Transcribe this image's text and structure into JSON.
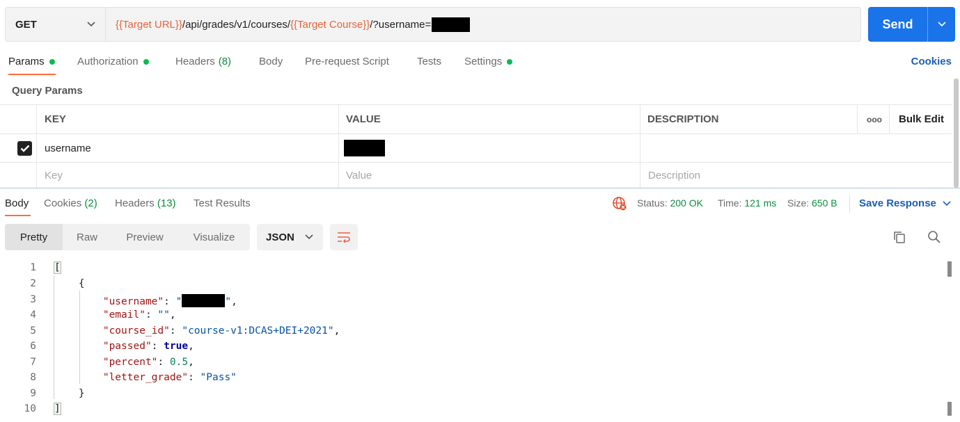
{
  "request": {
    "method": "GET",
    "url_parts": [
      {
        "text": "{{Target URL}}",
        "kind": "var"
      },
      {
        "text": "/api/grades/v1/courses/",
        "kind": "plain"
      },
      {
        "text": "{{Target Course}}",
        "kind": "var"
      },
      {
        "text": "/?username=",
        "kind": "plain"
      }
    ],
    "send_label": "Send"
  },
  "request_tabs": [
    {
      "label": "Params",
      "dot": true,
      "active": true
    },
    {
      "label": "Authorization",
      "dot": true
    },
    {
      "label": "Headers",
      "count": "(8)"
    },
    {
      "label": "Body"
    },
    {
      "label": "Pre-request Script"
    },
    {
      "label": "Tests"
    },
    {
      "label": "Settings",
      "dot": true
    }
  ],
  "cookies_link": "Cookies",
  "query_params": {
    "title": "Query Params",
    "headers": {
      "key": "KEY",
      "value": "VALUE",
      "description": "DESCRIPTION",
      "more": "ooo",
      "bulk_edit": "Bulk Edit"
    },
    "rows": [
      {
        "key": "username",
        "checked": true
      }
    ],
    "placeholders": {
      "key": "Key",
      "value": "Value",
      "description": "Description"
    }
  },
  "response_tabs": {
    "body": "Body",
    "cookies": "Cookies",
    "cookies_count": "(2)",
    "headers": "Headers",
    "headers_count": "(13)",
    "test_results": "Test Results"
  },
  "response_status": {
    "status_label": "Status:",
    "status_value": "200 OK",
    "time_label": "Time:",
    "time_value": "121 ms",
    "size_label": "Size:",
    "size_value": "650 B",
    "save_response": "Save Response"
  },
  "view_modes": [
    "Pretty",
    "Raw",
    "Preview",
    "Visualize"
  ],
  "format": "JSON",
  "code_line_numbers": [
    "1",
    "2",
    "3",
    "4",
    "5",
    "6",
    "7",
    "8",
    "9",
    "10"
  ],
  "json_body": {
    "username_key": "\"username\"",
    "email_key": "\"email\"",
    "email_value": "\"\"",
    "course_id_key": "\"course_id\"",
    "course_id_value": "\"course-v1:DCAS+DEI+2021\"",
    "passed_key": "\"passed\"",
    "passed_value": "true",
    "percent_key": "\"percent\"",
    "percent_value": "0.5",
    "letter_grade_key": "\"letter_grade\"",
    "letter_grade_value": "\"Pass\""
  },
  "colors": {
    "accent": "#ff6c37",
    "send_button": "#1a73e8",
    "variable": "#e8643a",
    "success": "#0a8d3f"
  },
  "icons": [
    "chevron-down-icon",
    "checkbox-checked-icon",
    "globe-error-icon",
    "word-wrap-icon",
    "copy-icon",
    "search-icon"
  ]
}
